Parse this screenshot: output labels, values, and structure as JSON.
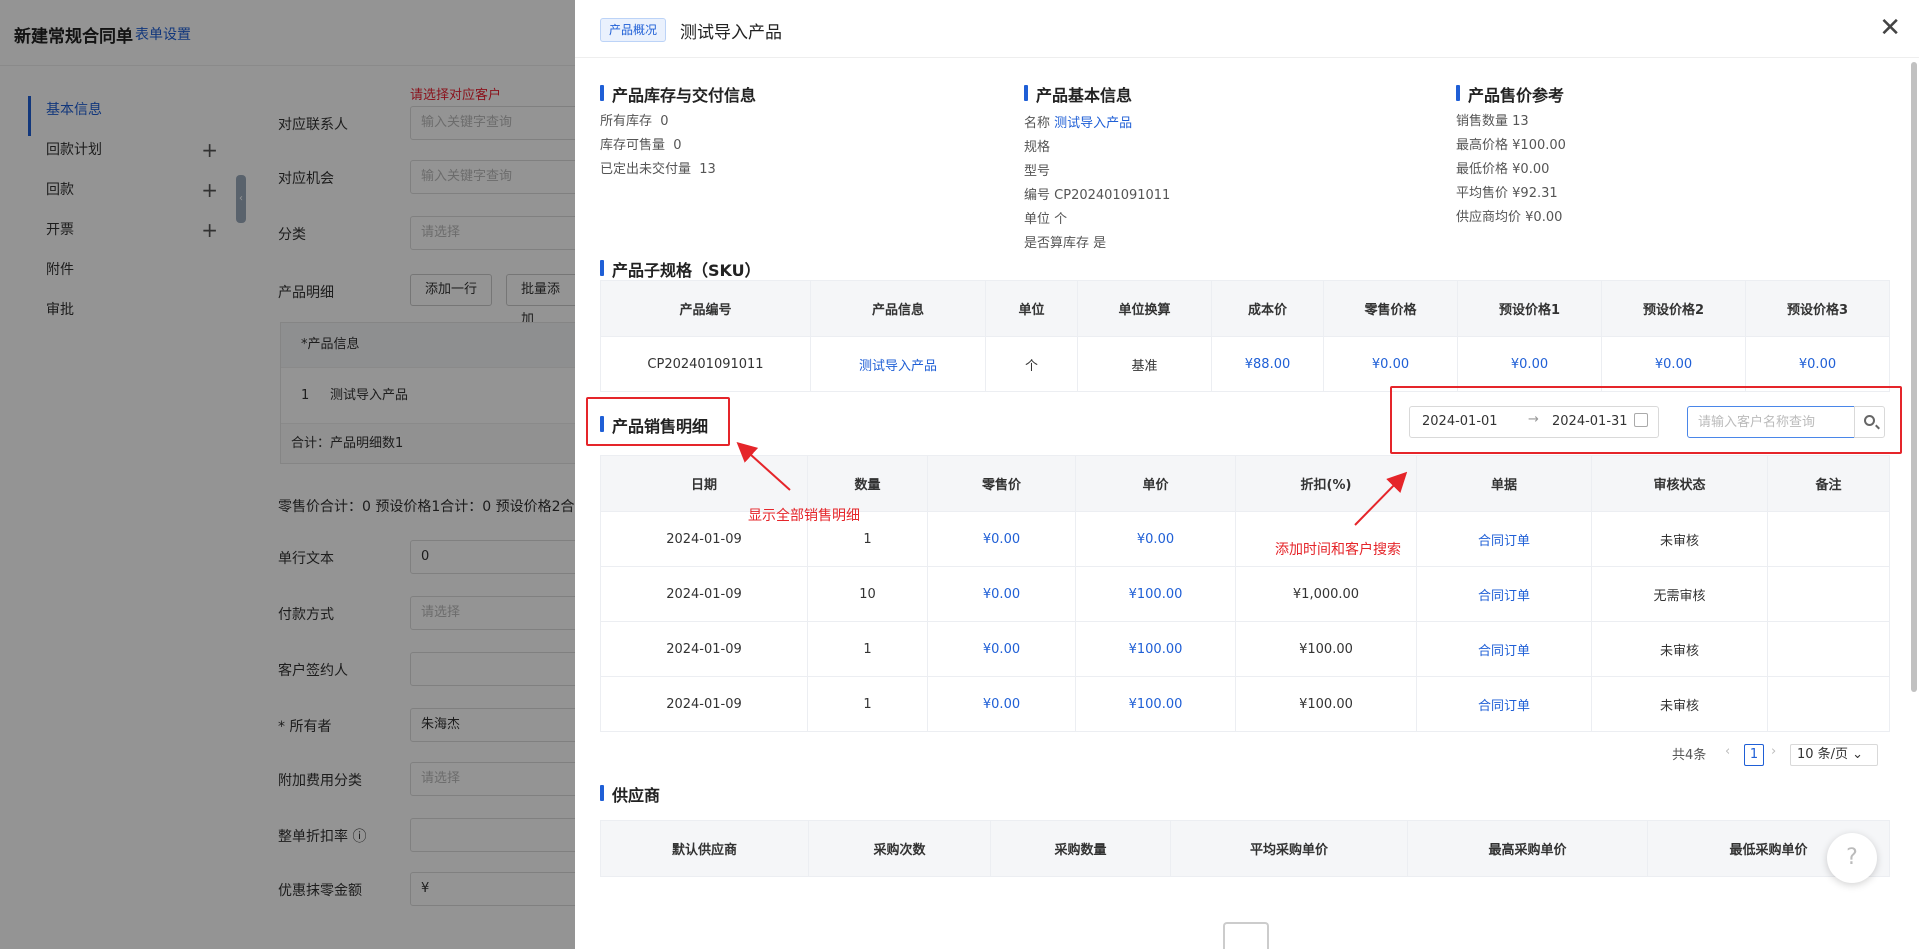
{
  "background": {
    "title": "新建常规合同单",
    "title_link": "表单设置",
    "nav": [
      {
        "label": "基本信息",
        "plus": ""
      },
      {
        "label": "回款计划",
        "plus": "+"
      },
      {
        "label": "回款",
        "plus": "+"
      },
      {
        "label": "开票",
        "plus": "+"
      },
      {
        "label": "附件",
        "plus": ""
      },
      {
        "label": "审批",
        "plus": ""
      }
    ],
    "error_text": "请选择对应客户",
    "fields": {
      "contact_label": "对应联系人",
      "contact_placeholder": "输入关键字查询",
      "opportunity_label": "对应机会",
      "opportunity_placeholder": "输入关键字查询",
      "category_label": "分类",
      "category_placeholder": "请选择",
      "detail_label": "产品明细",
      "add_row": "添加一行",
      "batch_add": "批量添加",
      "table_col_product": "*产品信息",
      "table_row_index": "1",
      "table_row_name": "测试导入产品",
      "table_total": "合计：产品明细数1",
      "sum_text": "零售价合计：0 预设价格1合计：0 预设价格2合",
      "single_text_label": "单行文本",
      "single_text_value": "0",
      "pay_label": "付款方式",
      "pay_placeholder": "请选择",
      "signer_label": "客户签约人",
      "owner_label": "* 所有者",
      "owner_value": "朱海杰",
      "fee_label": "附加费用分类",
      "fee_placeholder": "请选择",
      "discount_label": "整单折扣率 ⓘ",
      "round_label": "优惠抹零金额",
      "round_value": "¥"
    }
  },
  "drawer": {
    "tag": "产品概况",
    "title": "测试导入产品",
    "inventory": {
      "title": "产品库存与交付信息",
      "rows": [
        {
          "k": "所有库存",
          "v": "0"
        },
        {
          "k": "库存可售量",
          "v": "0"
        },
        {
          "k": "已定出未交付量",
          "v": "13"
        }
      ]
    },
    "basic": {
      "title": "产品基本信息",
      "name_k": "名称",
      "name_v": "测试导入产品",
      "spec": "规格",
      "model": "型号",
      "code_k": "编号",
      "code_v": "CP202401091011",
      "unit_k": "单位",
      "unit_v": "个",
      "stock_k": "是否算库存",
      "stock_v": "是"
    },
    "price_ref": {
      "title": "产品售价参考",
      "rows": [
        {
          "k": "销售数量",
          "v": "13"
        },
        {
          "k": "最高价格",
          "v": "¥100.00"
        },
        {
          "k": "最低价格",
          "v": "¥0.00"
        },
        {
          "k": "平均售价",
          "v": "¥92.31"
        },
        {
          "k": "供应商均价",
          "v": "¥0.00"
        }
      ]
    },
    "sku": {
      "title": "产品子规格（SKU）",
      "headers": [
        "产品编号",
        "产品信息",
        "单位",
        "单位换算",
        "成本价",
        "零售价格",
        "预设价格1",
        "预设价格2",
        "预设价格3"
      ],
      "row": [
        "CP202401091011",
        "测试导入产品",
        "个",
        "基准",
        "¥88.00",
        "¥0.00",
        "¥0.00",
        "¥0.00",
        "¥0.00"
      ]
    },
    "sales": {
      "title": "产品销售明细",
      "date_start": "2024-01-01",
      "date_arrow": "→",
      "date_end": "2024-01-31",
      "search_placeholder": "请输入客户名称查询",
      "headers": [
        "日期",
        "数量",
        "零售价",
        "单价",
        "折扣(%)",
        "单据",
        "审核状态",
        "备注"
      ],
      "rows": [
        [
          "2024-01-09",
          "1",
          "¥0.00",
          "¥0.00",
          "",
          "合同订单",
          "未审核",
          ""
        ],
        [
          "2024-01-09",
          "10",
          "¥0.00",
          "¥100.00",
          "¥1,000.00",
          "合同订单",
          "无需审核",
          ""
        ],
        [
          "2024-01-09",
          "1",
          "¥0.00",
          "¥100.00",
          "¥100.00",
          "合同订单",
          "未审核",
          ""
        ],
        [
          "2024-01-09",
          "1",
          "¥0.00",
          "¥100.00",
          "¥100.00",
          "合同订单",
          "未审核",
          ""
        ]
      ],
      "total": "共4条",
      "page": "1",
      "page_size": "10 条/页 ⌄"
    },
    "supplier": {
      "title": "供应商",
      "headers": [
        "默认供应商",
        "采购次数",
        "采购数量",
        "平均采购单价",
        "最高采购单价",
        "最低采购单价"
      ]
    },
    "annotations": {
      "left": "显示全部销售明细",
      "right": "添加时间和客户搜索"
    },
    "colors": {
      "accent": "#1f5fd6",
      "annotation": "#e5252a"
    }
  }
}
